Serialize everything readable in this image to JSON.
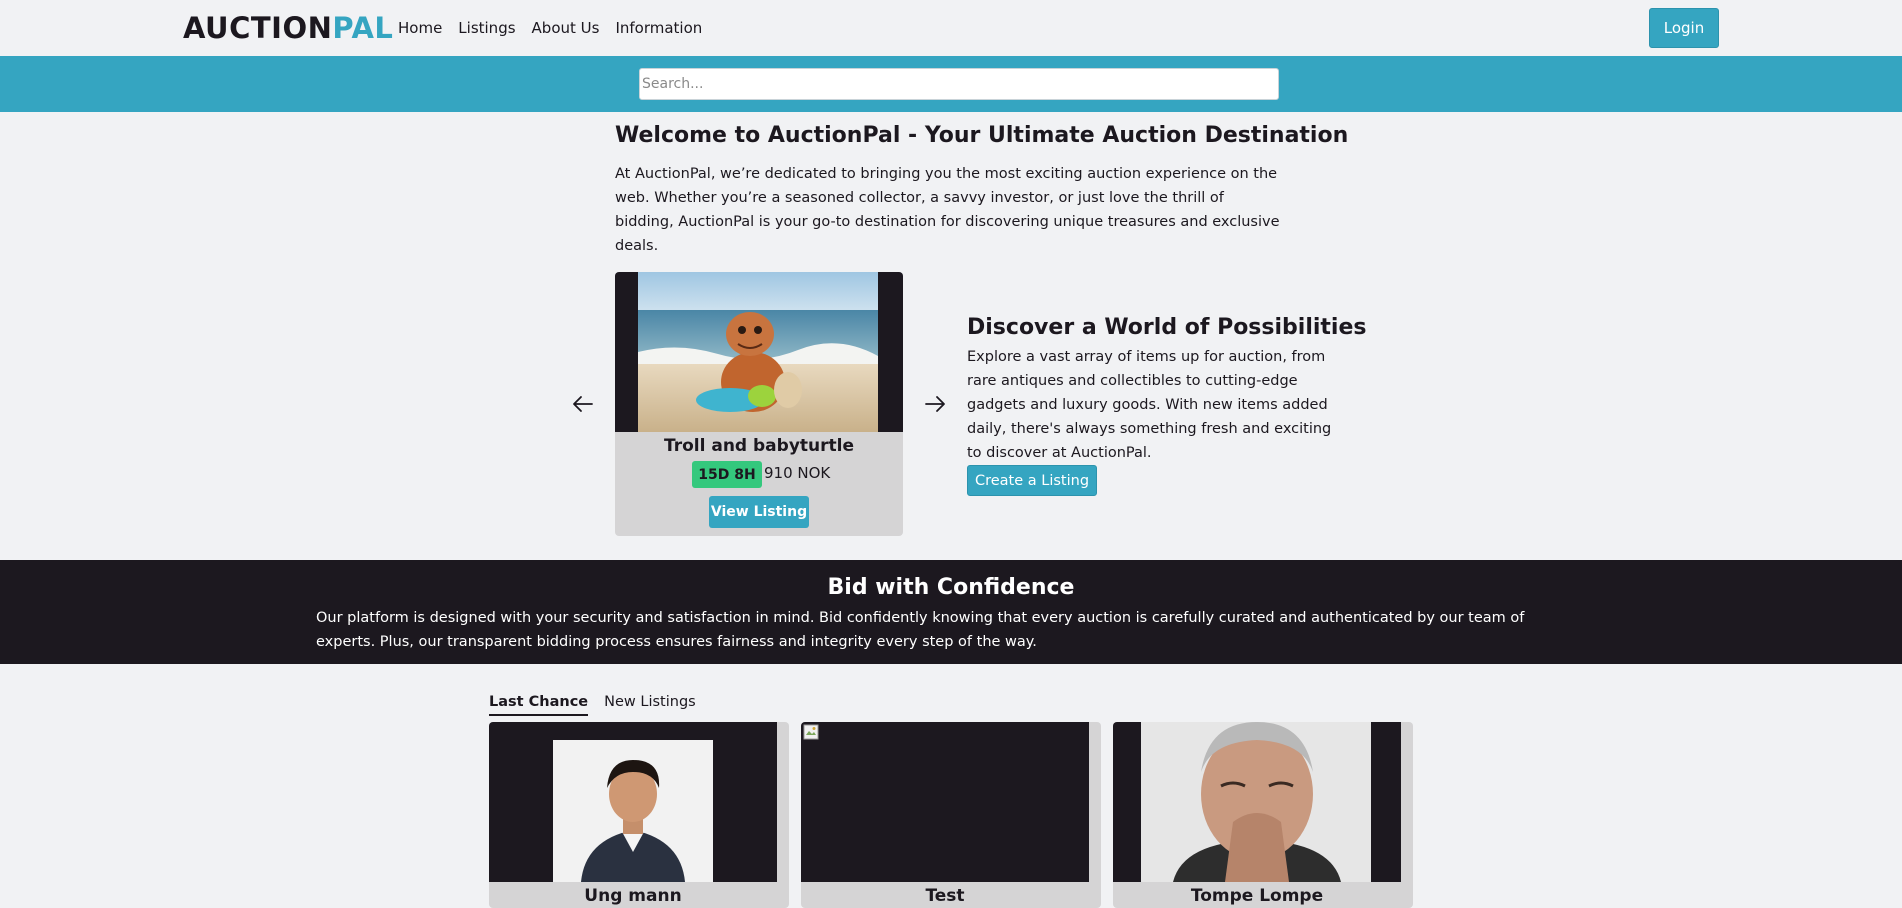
{
  "header": {
    "logo_part1": "AUCTION",
    "logo_part2": "PAL",
    "nav": [
      "Home",
      "Listings",
      "About Us",
      "Information"
    ],
    "login_label": "Login"
  },
  "search": {
    "placeholder": "Search..."
  },
  "intro": {
    "title": "Welcome to AuctionPal - Your Ultimate Auction Destination",
    "text": "At AuctionPal, we’re dedicated to bringing you the most exciting auction experience on the web. Whether you’re a seasoned collector, a savvy investor, or just love the thrill of bidding, AuctionPal is your go-to destination for discovering unique treasures and exclusive deals."
  },
  "featured": {
    "title": "Troll and babyturtle",
    "time_left": "15D 8H",
    "price": "910 NOK",
    "view_label": "View Listing"
  },
  "discover": {
    "title": "Discover a World of Possibilities",
    "text": "Explore a vast array of items up for auction, from rare antiques and collectibles to cutting-edge gadgets and luxury goods. With new items added daily, there's always something fresh and exciting to discover at AuctionPal.",
    "create_label": "Create a Listing"
  },
  "confidence": {
    "title": "Bid with Confidence",
    "text": "Our platform is designed with your security and satisfaction in mind. Bid confidently knowing that every auction is carefully curated and authenticated by our team of experts. Plus, our transparent bidding process ensures fairness and integrity every step of the way."
  },
  "tabs": [
    "Last Chance",
    "New Listings"
  ],
  "listings": [
    {
      "title": "Ung mann"
    },
    {
      "title": "Test"
    },
    {
      "title": "Tompe Lompe"
    }
  ],
  "colors": {
    "accent": "#35a5c1",
    "dark": "#1c181f",
    "timer_green": "#34c87d",
    "card_bg": "#d5d4d5"
  }
}
